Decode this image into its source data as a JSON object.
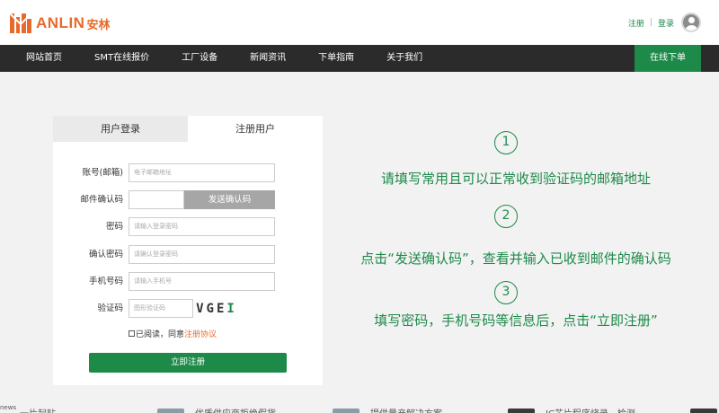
{
  "header": {
    "logo_text": "ANLIN",
    "logo_cn": "安林",
    "register": "注册",
    "separator": "|",
    "login": "登录"
  },
  "nav": {
    "items": [
      "网站首页",
      "SMT在线报价",
      "工厂设备",
      "新闻资讯",
      "下单指南",
      "关于我们"
    ],
    "cta": "在线下单"
  },
  "form": {
    "tabs": {
      "login": "用户登录",
      "register": "注册用户"
    },
    "account_label": "账号(邮箱)",
    "account_placeholder": "电子邮箱地址",
    "email_code_label": "邮件确认码",
    "send_code": "发送确认码",
    "password_label": "密码",
    "password_placeholder": "请输入登录密码",
    "confirm_label": "确认密码",
    "confirm_placeholder": "请确认登录密码",
    "phone_label": "手机号码",
    "phone_placeholder": "请输入手机号",
    "captcha_label": "验证码",
    "captcha_placeholder": "图形验证码",
    "captcha_text": "VGE",
    "captcha_last": "I",
    "agree_text": "已阅读，同意",
    "agree_link": "注册协议",
    "submit": "立即注册"
  },
  "steps": [
    {
      "num": "1",
      "text": "请填写常用且可以正常收到验证码的邮箱地址"
    },
    {
      "num": "2",
      "text": "点击“发送确认码”，查看并输入已收到邮件的确认码"
    },
    {
      "num": "3",
      "text": "填写密码，手机号码等信息后，点击“立即注册”"
    }
  ],
  "bottom_strip": {
    "badge": "news",
    "items": [
      "一片起贴",
      "优质供应商拒绝假货",
      "提供量产解决方案",
      "IC芯片程序烧录，检测"
    ]
  },
  "colors": {
    "brand_green": "#1d8a4a",
    "brand_orange": "#e86a2a",
    "nav_bg": "#2b2b2b"
  }
}
